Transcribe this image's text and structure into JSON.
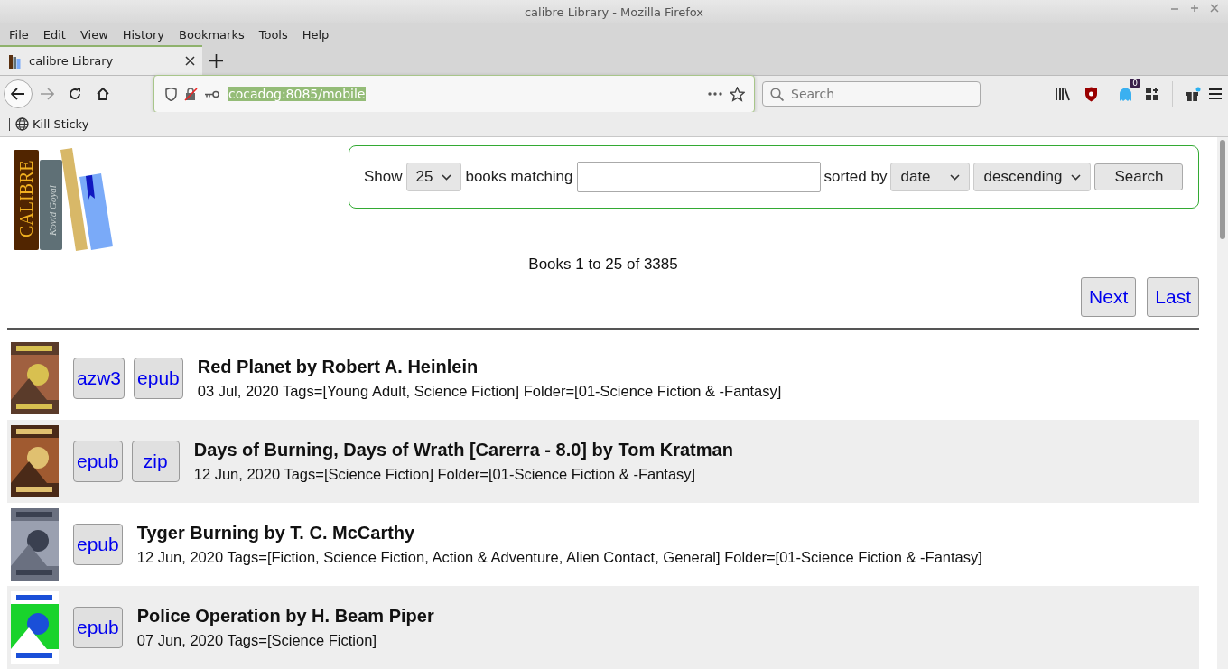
{
  "window": {
    "title": "calibre Library - Mozilla Firefox"
  },
  "menu": [
    "File",
    "Edit",
    "View",
    "History",
    "Bookmarks",
    "Tools",
    "Help"
  ],
  "tabs": [
    {
      "label": "calibre Library",
      "selected": true
    }
  ],
  "address": {
    "url": "cocadog:8085/mobile"
  },
  "search": {
    "placeholder": "Search"
  },
  "extension_badge": "0",
  "bookmarks": [
    "Kill Sticky"
  ],
  "logo": {
    "title": "CALIBRE",
    "author": "Kovid Goyal"
  },
  "query": {
    "show_label": "Show",
    "page_size": "25",
    "matching_label": "books matching",
    "sorted_label": "sorted by",
    "sort_field": "date",
    "sort_order": "descending",
    "search_button": "Search"
  },
  "summary": "Books 1 to 25 of 3385",
  "pager": [
    "Next",
    "Last"
  ],
  "books": [
    {
      "formats": [
        "azw3",
        "epub"
      ],
      "title": "Red Planet by Robert A. Heinlein",
      "details": "03 Jul, 2020 Tags=[Young Adult, Science Fiction] Folder=[01-Science Fiction & -Fantasy]",
      "cover": {
        "kind": "picture"
      }
    },
    {
      "formats": [
        "epub",
        "zip"
      ],
      "title": "Days of Burning, Days of Wrath [Carerra - 8.0] by Tom Kratman",
      "details": "12 Jun, 2020 Tags=[Science Fiction] Folder=[01-Science Fiction & -Fantasy]",
      "cover": {
        "kind": "picture"
      }
    },
    {
      "formats": [
        "epub"
      ],
      "title": "Tyger Burning by T. C. McCarthy",
      "details": "12 Jun, 2020 Tags=[Fiction, Science Fiction, Action & Adventure, Alien Contact, General] Folder=[01-Science Fiction & -Fantasy]",
      "cover": {
        "kind": "picture"
      }
    },
    {
      "formats": [
        "epub"
      ],
      "title": "Police Operation by H. Beam Piper",
      "details": "07 Jun, 2020 Tags=[Science Fiction]",
      "cover": {
        "kind": "picture"
      }
    }
  ]
}
